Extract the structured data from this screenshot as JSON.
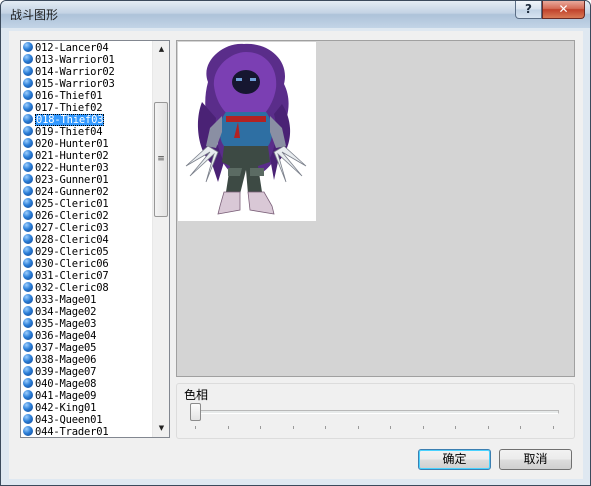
{
  "window": {
    "title": "战斗图形",
    "help_label": "?",
    "close_label": "✕"
  },
  "list": {
    "selected_index": 6,
    "items": [
      "012-Lancer04",
      "013-Warrior01",
      "014-Warrior02",
      "015-Warrior03",
      "016-Thief01",
      "017-Thief02",
      "018-Thief03",
      "019-Thief04",
      "020-Hunter01",
      "021-Hunter02",
      "022-Hunter03",
      "023-Gunner01",
      "024-Gunner02",
      "025-Cleric01",
      "026-Cleric02",
      "027-Cleric03",
      "028-Cleric04",
      "029-Cleric05",
      "030-Cleric06",
      "031-Cleric07",
      "032-Cleric08",
      "033-Mage01",
      "034-Mage02",
      "035-Mage03",
      "036-Mage04",
      "037-Mage05",
      "038-Mage06",
      "039-Mage07",
      "040-Mage08",
      "041-Mage09",
      "042-King01",
      "043-Queen01",
      "044-Trader01"
    ],
    "scroll_up_icon": "triangle-up",
    "scroll_down_icon": "triangle-down"
  },
  "hue": {
    "label": "色相",
    "value": 0
  },
  "buttons": {
    "ok_label": "确定",
    "cancel_label": "取消"
  },
  "colors": {
    "selection": "#3399ff",
    "preview_bg": "#d4d4d4"
  }
}
